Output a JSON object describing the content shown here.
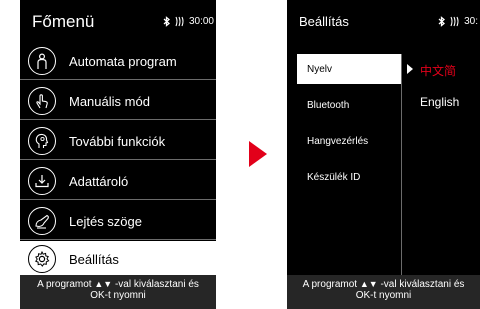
{
  "left_screen": {
    "title": "Főmenü",
    "status": {
      "bluetooth_icon": "bluetooth-icon",
      "signal_icon": "signal-icon",
      "time": "30:00"
    },
    "menu_items": [
      {
        "label": "Automata program",
        "icon": "person-outline-icon"
      },
      {
        "label": "Manuális mód",
        "icon": "hand-pointer-icon"
      },
      {
        "label": "További funkciók",
        "icon": "head-profile-icon"
      },
      {
        "label": "Adattároló",
        "icon": "download-tray-icon"
      },
      {
        "label": "Lejtés szöge",
        "icon": "recline-chair-icon"
      },
      {
        "label": "Beállítás",
        "icon": "gear-icon",
        "selected": true
      }
    ],
    "footer": {
      "line1_prefix": "A programot",
      "line1_suffix": "-val kiválasztani és",
      "line2": "OK-t nyomni"
    }
  },
  "arrow": {
    "icon": "next-arrow-icon",
    "color": "#e2001a"
  },
  "right_screen": {
    "title": "Beállítás",
    "status": {
      "bluetooth_icon": "bluetooth-icon",
      "signal_icon": "signal-icon",
      "time": "30:"
    },
    "settings_items": [
      {
        "label": "Nyelv",
        "selected": true
      },
      {
        "label": "Bluetooth"
      },
      {
        "label": "Hangvezérlés"
      },
      {
        "label": "Készülék ID"
      }
    ],
    "language_options": [
      {
        "label": "中文简",
        "active": true
      },
      {
        "label": "English",
        "active": false
      }
    ],
    "footer": {
      "line1_prefix": "A programot",
      "line1_suffix": "-val kiválasztani és",
      "line2": "OK-t nyomni"
    }
  },
  "colors": {
    "accent": "#e2001a",
    "screen_bg": "#000000",
    "footer_bg": "#262626",
    "divider": "#6b6b6b"
  }
}
